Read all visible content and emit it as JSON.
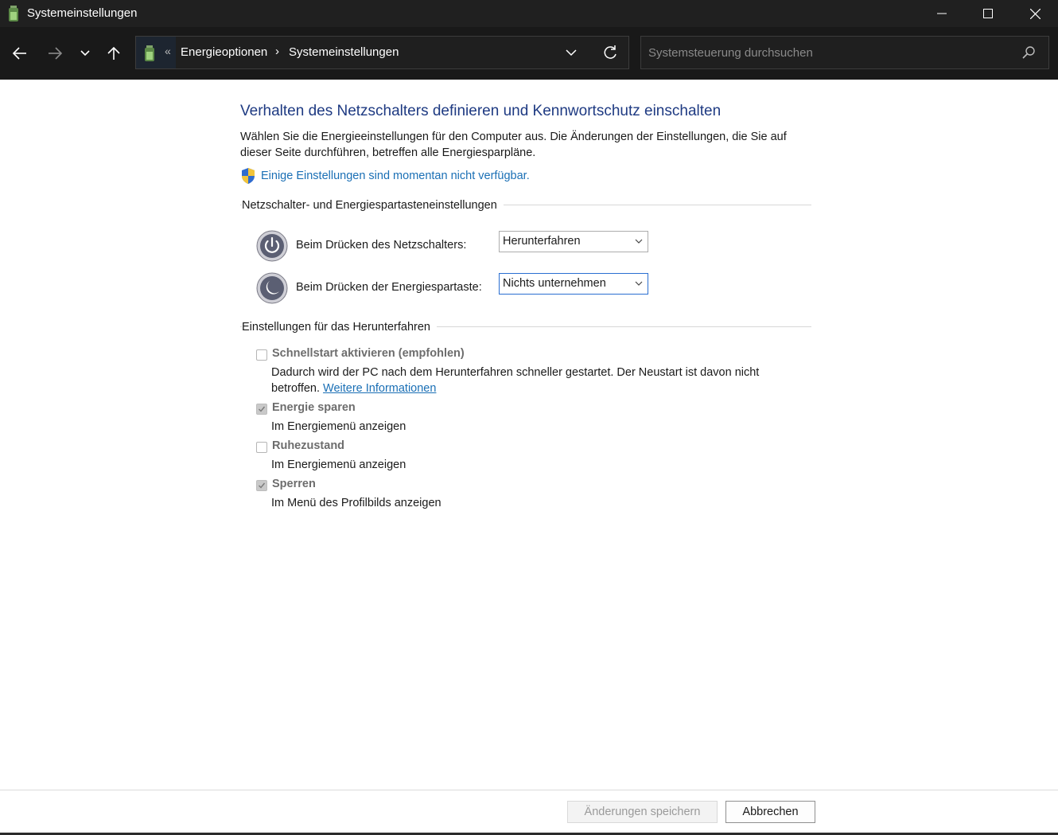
{
  "window": {
    "title": "Systemeinstellungen"
  },
  "address": {
    "overflow_glyph": "«",
    "crumbs": [
      "Energieoptionen",
      "Systemeinstellungen"
    ],
    "separator": "›"
  },
  "search": {
    "placeholder": "Systemsteuerung durchsuchen",
    "value": ""
  },
  "page": {
    "heading": "Verhalten des Netzschalters definieren und Kennwortschutz einschalten",
    "description": "Wählen Sie die Energieeinstellungen für den Computer aus. Die Änderungen der Einstellungen, die Sie auf dieser Seite durchführen, betreffen alle Energiesparpläne.",
    "notice_link": "Einige Einstellungen sind momentan nicht verfügbar."
  },
  "buttons_section": {
    "title": "Netzschalter- und Energiespartasteneinstellungen",
    "power_button_label": "Beim Drücken des Netzschalters:",
    "power_button_value": "Herunterfahren",
    "sleep_button_label": "Beim Drücken der Energiespartaste:",
    "sleep_button_value": "Nichts unternehmen"
  },
  "shutdown_section": {
    "title": "Einstellungen für das Herunterfahren",
    "items": [
      {
        "label": "Schnellstart aktivieren (empfohlen)",
        "desc": "Dadurch wird der PC nach dem Herunterfahren schneller gestartet. Der Neustart ist davon nicht betroffen.",
        "link": "Weitere Informationen",
        "checked": false
      },
      {
        "label": "Energie sparen",
        "desc": "Im Energiemenü anzeigen",
        "checked": true
      },
      {
        "label": "Ruhezustand",
        "desc": "Im Energiemenü anzeigen",
        "checked": false
      },
      {
        "label": "Sperren",
        "desc": "Im Menü des Profilbilds anzeigen",
        "checked": true
      }
    ]
  },
  "footer": {
    "save_label": "Änderungen speichern",
    "cancel_label": "Abbrechen"
  },
  "colors": {
    "heading": "#1e3a82",
    "link": "#1a6fb5",
    "titlebar": "#202020",
    "navbar": "#191919"
  }
}
